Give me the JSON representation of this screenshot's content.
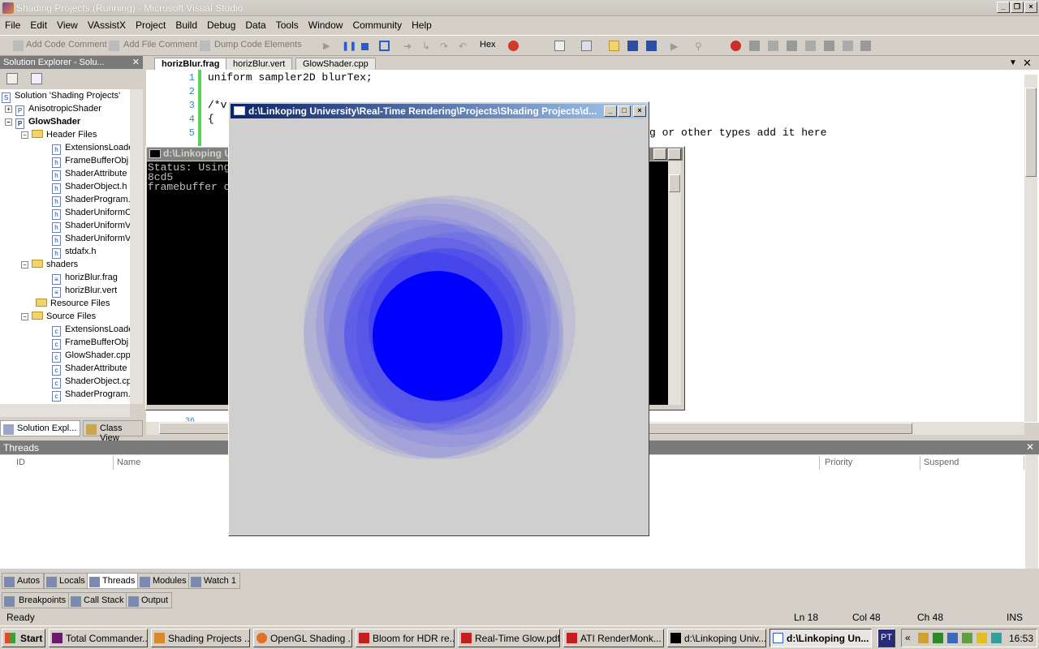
{
  "window": {
    "title": "Shading Projects (Running) - Microsoft Visual Studio"
  },
  "menu": [
    "File",
    "Edit",
    "View",
    "VAssistX",
    "Project",
    "Build",
    "Debug",
    "Data",
    "Tools",
    "Window",
    "Community",
    "Help"
  ],
  "toolbar": {
    "add_code_comment": "Add Code Comment",
    "add_file_comment": "Add File Comment",
    "dump_code": "Dump Code Elements",
    "hex": "Hex"
  },
  "solution_explorer": {
    "header": "Solution Explorer - Solu...",
    "items": [
      {
        "label": "Solution 'Shading Projects'"
      },
      {
        "label": "AnisotropicShader"
      },
      {
        "label": "GlowShader"
      },
      {
        "label": "Header Files"
      },
      {
        "label": "ExtensionsLoade"
      },
      {
        "label": "FrameBufferObj"
      },
      {
        "label": "ShaderAttribute"
      },
      {
        "label": "ShaderObject.h"
      },
      {
        "label": "ShaderProgram."
      },
      {
        "label": "ShaderUniformC"
      },
      {
        "label": "ShaderUniformV"
      },
      {
        "label": "ShaderUniformV"
      },
      {
        "label": "stdafx.h"
      },
      {
        "label": "shaders"
      },
      {
        "label": "horizBlur.frag"
      },
      {
        "label": "horizBlur.vert"
      },
      {
        "label": "Resource Files"
      },
      {
        "label": "Source Files"
      },
      {
        "label": "ExtensionsLoade"
      },
      {
        "label": "FrameBufferObj"
      },
      {
        "label": "GlowShader.cpp"
      },
      {
        "label": "ShaderAttribute"
      },
      {
        "label": "ShaderObject.cp"
      },
      {
        "label": "ShaderProgram."
      }
    ],
    "tab_solution": "Solution Expl...",
    "tab_class": "Class View"
  },
  "editor": {
    "tabs": [
      "horizBlur.frag",
      "horizBlur.vert",
      "GlowShader.cpp"
    ],
    "line_numbers": [
      "1",
      "2",
      "3",
      "4",
      "5"
    ],
    "lines": [
      "uniform sampler2D blurTex;",
      "",
      "/*v",
      "{",
      ""
    ],
    "overflow_text": "g or other types add it here",
    "bottom_line_number": "36"
  },
  "console": {
    "title": "d:\\Linkoping Un",
    "lines": [
      "Status: Using",
      "8cd5",
      "framebuffer c"
    ]
  },
  "gl_window": {
    "title": "d:\\Linkoping University\\Real-Time Rendering\\Projects\\Shading Projects\\d..."
  },
  "threads": {
    "title": "Threads",
    "columns": [
      "ID",
      "Name",
      "Priority",
      "Suspend"
    ]
  },
  "bottom_tabs": [
    "Autos",
    "Locals",
    "Threads",
    "Modules",
    "Watch 1"
  ],
  "bottom_tabs2": [
    "Breakpoints",
    "Call Stack",
    "Output"
  ],
  "status": {
    "ready": "Ready",
    "ln": "Ln 18",
    "col": "Col 48",
    "ch": "Ch 48",
    "ins": "INS"
  },
  "taskbar": {
    "start": "Start",
    "tasks": [
      "Total Commander...",
      "Shading Projects ...",
      "OpenGL Shading ...",
      "Bloom for HDR re...",
      "Real-Time Glow.pdf",
      "ATI RenderMonk...",
      "d:\\Linkoping Univ...",
      "d:\\Linkoping Un..."
    ],
    "lang": "PT",
    "clock": "16:53"
  },
  "colors": {
    "glow": "#0000ff",
    "canvas_bg": "#cfcfcf"
  }
}
